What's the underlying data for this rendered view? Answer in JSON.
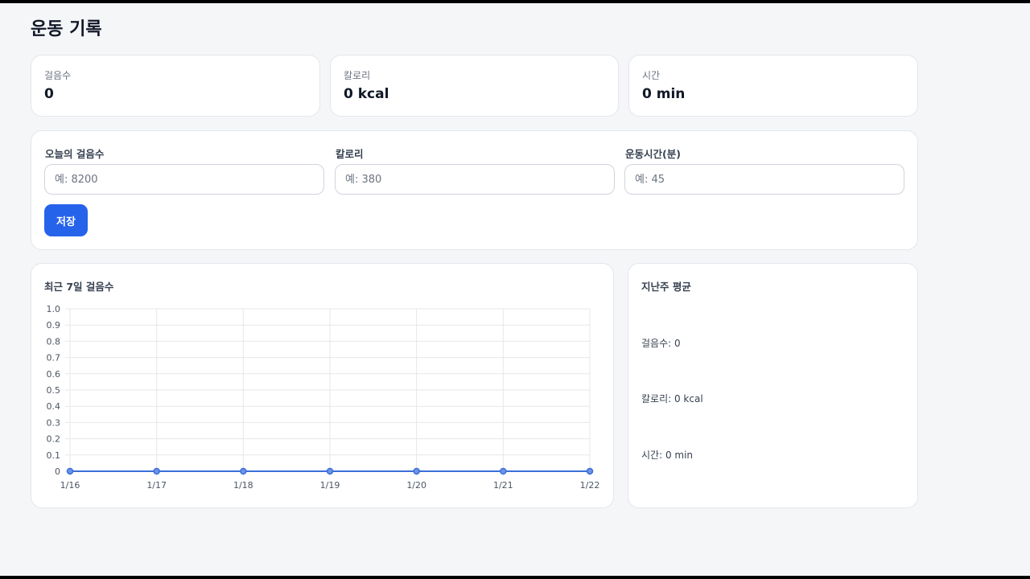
{
  "page": {
    "title": "운동 기록"
  },
  "stats": {
    "steps": {
      "label": "걸음수",
      "value": "0"
    },
    "calories": {
      "label": "칼로리",
      "value": "0 kcal"
    },
    "time": {
      "label": "시간",
      "value": "0 min"
    }
  },
  "form": {
    "steps": {
      "label": "오늘의 걸음수",
      "placeholder": "예: 8200"
    },
    "calories": {
      "label": "칼로리",
      "placeholder": "예: 380"
    },
    "duration": {
      "label": "운동시간(분)",
      "placeholder": "예: 45"
    },
    "save_label": "저장"
  },
  "chart": {
    "title": "최근 7일 걸음수"
  },
  "chart_data": {
    "type": "line",
    "title": "최근 7일 걸음수",
    "xlabel": "",
    "ylabel": "",
    "x": [
      "1/16",
      "1/17",
      "1/18",
      "1/19",
      "1/20",
      "1/21",
      "1/22"
    ],
    "series": [
      {
        "values": [
          0,
          0,
          0,
          0,
          0,
          0,
          0
        ]
      }
    ],
    "ylim": [
      0,
      1.0
    ],
    "yticks": [
      "0",
      "0.1",
      "0.2",
      "0.3",
      "0.4",
      "0.5",
      "0.6",
      "0.7",
      "0.8",
      "0.9",
      "1.0"
    ],
    "grid": true,
    "color": "#3b6fd8"
  },
  "weekly_avg": {
    "title": "지난주 평균",
    "steps": "걸음수: 0",
    "calories": "칼로리: 0 kcal",
    "time": "시간: 0 min"
  }
}
